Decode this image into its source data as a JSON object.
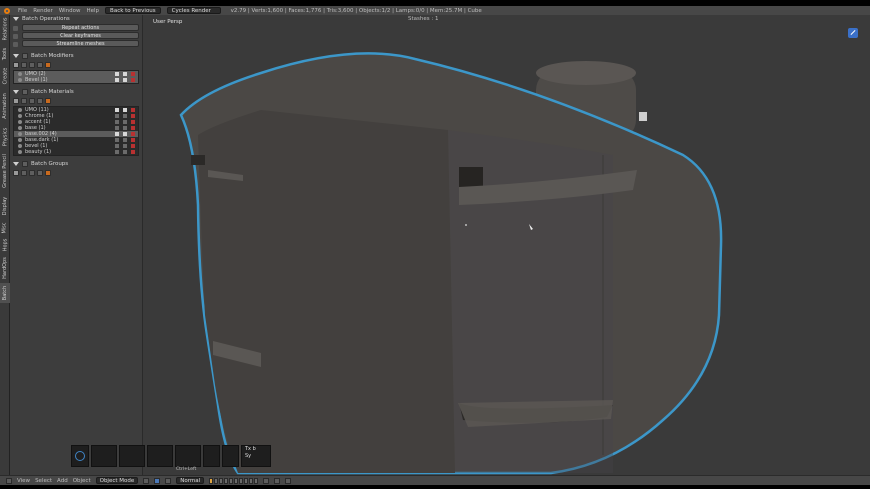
{
  "info_header": {
    "menus": [
      "File",
      "Render",
      "Window",
      "Help"
    ],
    "screen_layout": "Back to Previous",
    "render_engine": "Cycles Render",
    "stats": "v2.79 | Verts:1,600 | Faces:1,776 | Tris:3,600 | Objects:1/2 | Lamps:0/0 | Mem:25.7M | Cube"
  },
  "tabs": [
    "Relations",
    "Tools",
    "Create",
    "Animation",
    "Physics",
    "Grease Pencil",
    "Display",
    "Misc",
    "Hops",
    "HardOps",
    "Batch"
  ],
  "shelf": {
    "batch_operations": {
      "title": "Batch Operations",
      "buttons": [
        "Repeat actions",
        "Clear keyframes",
        "Streamline meshes"
      ]
    },
    "batch_modifiers": {
      "title": "Batch Modifiers",
      "items": [
        "UMO (2)",
        "Bevel (1)"
      ]
    },
    "batch_materials": {
      "title": "Batch Materials",
      "items": [
        "UMO (11)",
        "Chrome (1)",
        "accent (1)",
        "base (1)",
        "base.002 (4)",
        "base.dark (1)",
        "bevel (1)",
        "beauty (1)"
      ]
    },
    "batch_groups": {
      "title": "Batch Groups"
    }
  },
  "viewport": {
    "view_name": "User Persp",
    "stash_label": "Stashes :",
    "stash_count": "1"
  },
  "recent": {
    "text_line1": "Tx b",
    "text_line2": "Sy",
    "caption": "Ctrl+Left"
  },
  "bottom_header": {
    "menus": [
      "View",
      "Select",
      "Add",
      "Object"
    ],
    "mode": "Object Mode",
    "pivot": "Normal"
  },
  "colors": {
    "accent_orange": "#e87d0d",
    "selection_outline": "#3c97c9",
    "viewport_bg": "#3a3a3a",
    "model_surface": "#4b4845"
  }
}
